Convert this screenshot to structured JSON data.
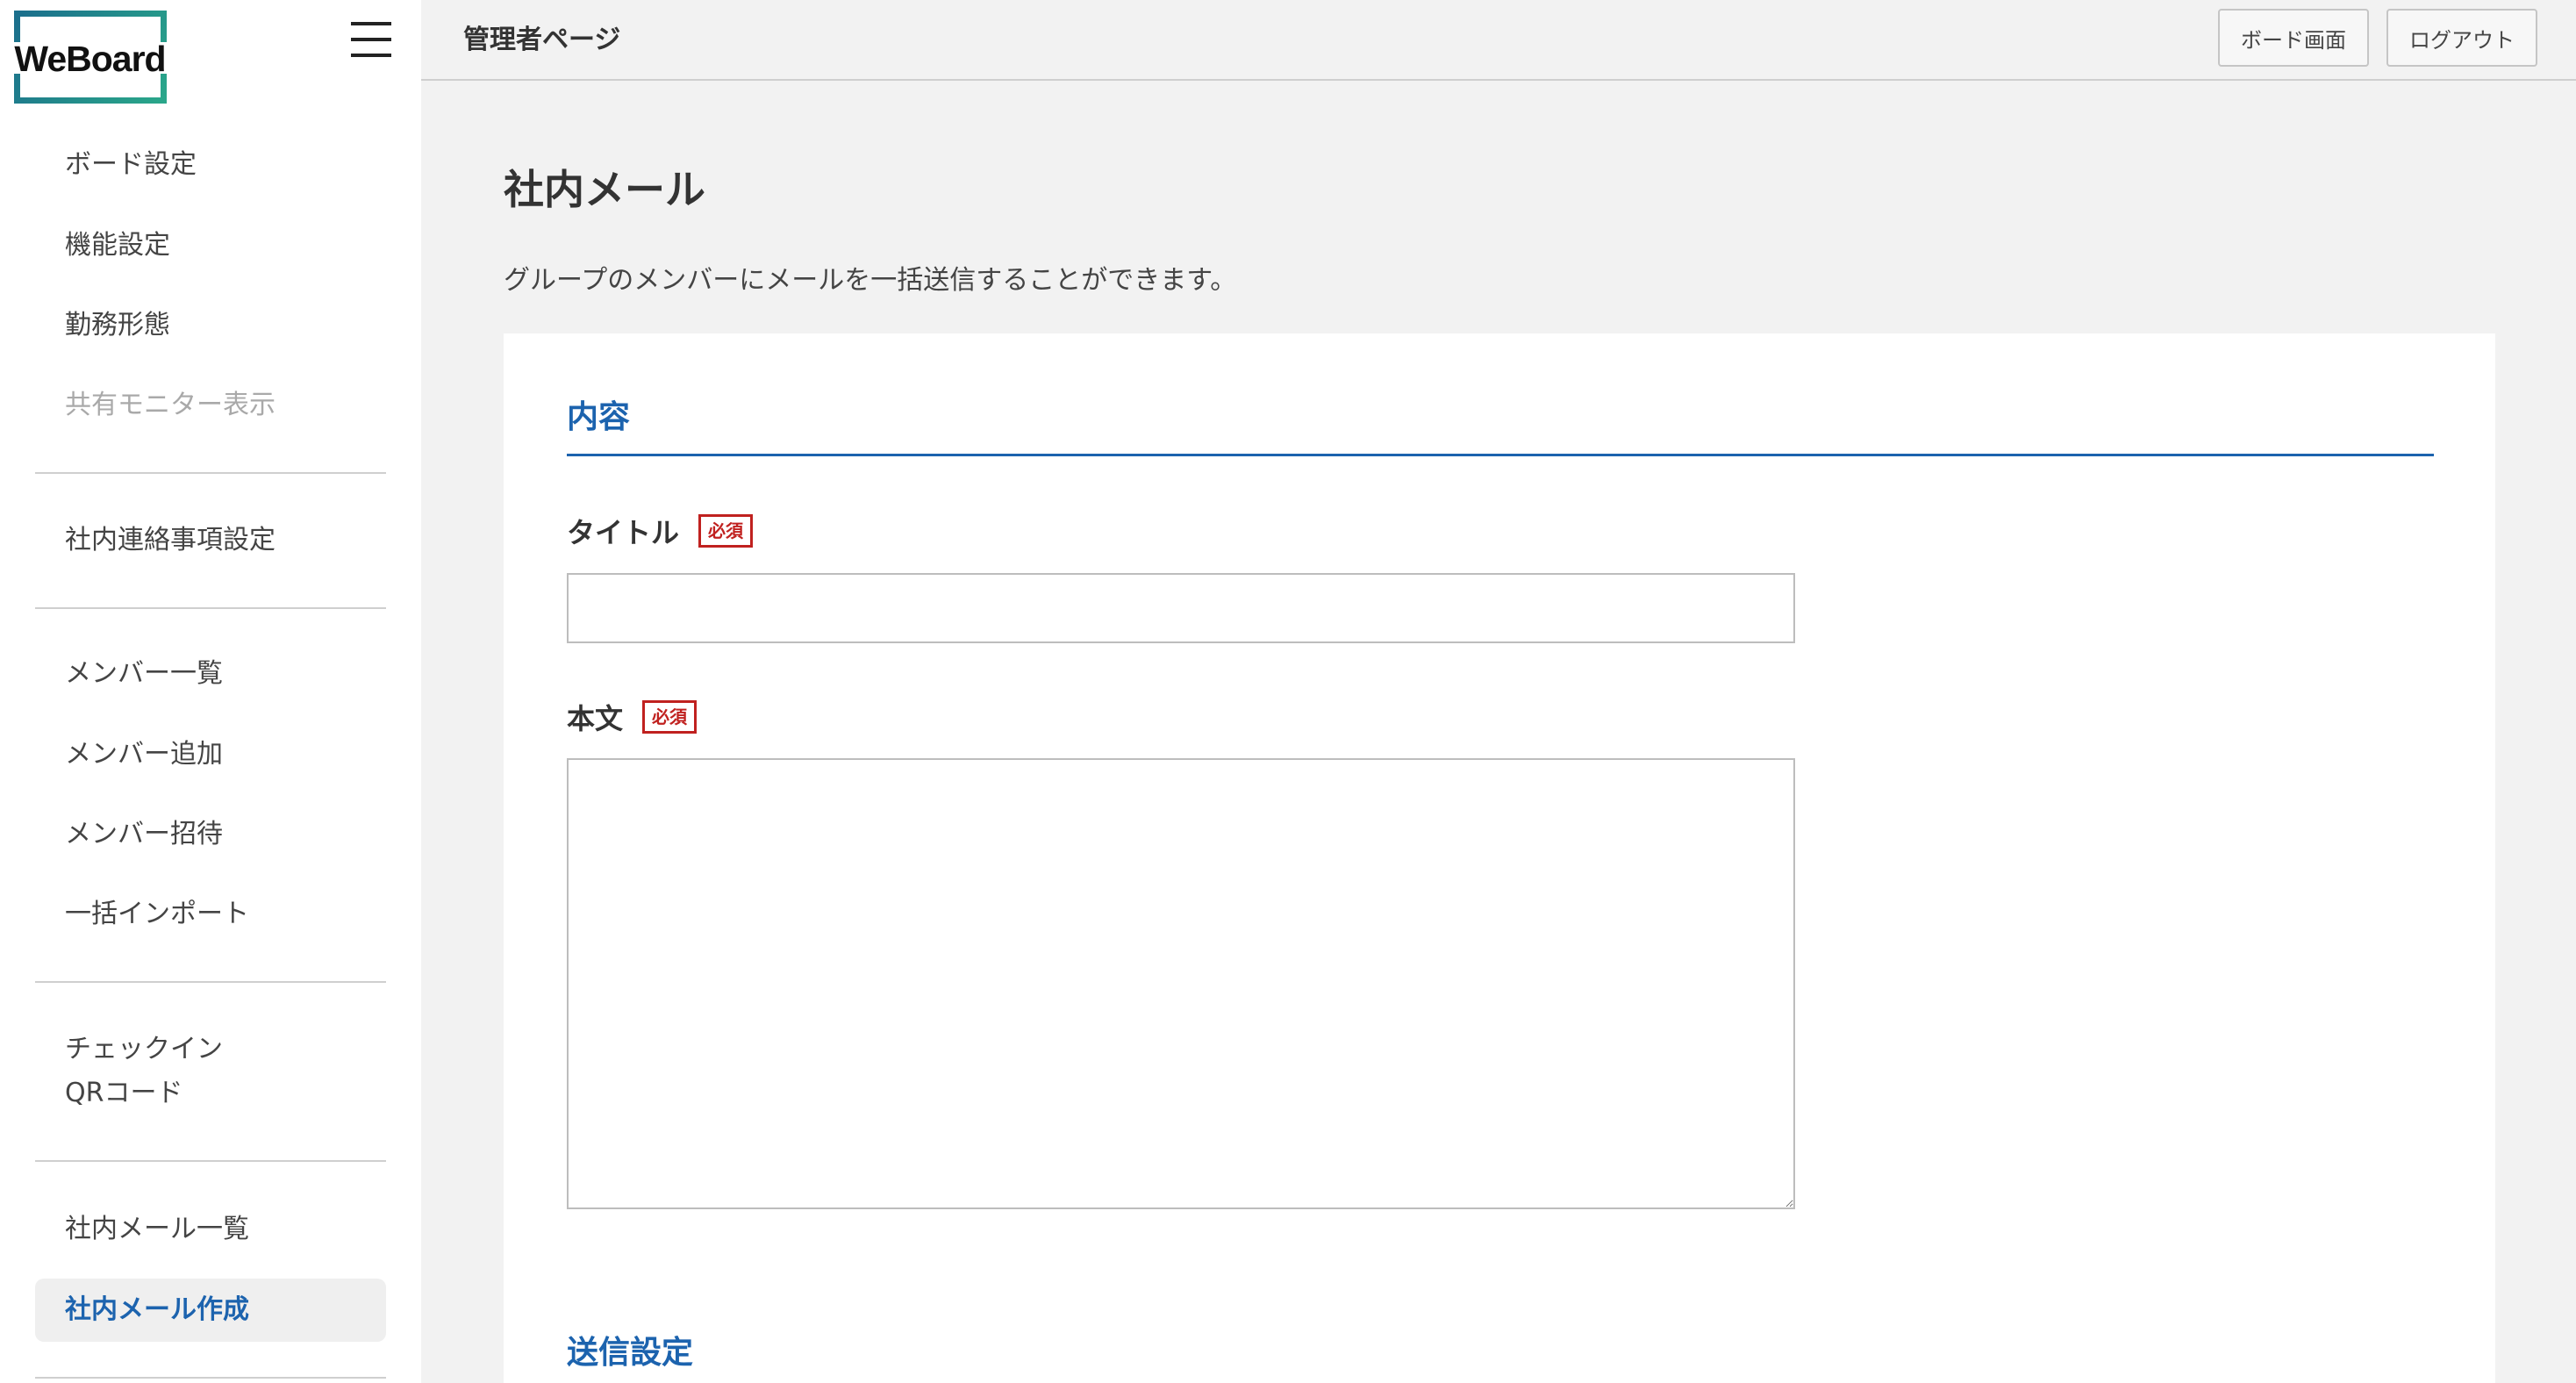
{
  "brand": {
    "logo_text": "WeBoard"
  },
  "header": {
    "title": "管理者ページ",
    "board_button": "ボード画面",
    "logout_button": "ログアウト"
  },
  "sidebar": {
    "items": [
      {
        "label": "ボード設定",
        "state": "normal"
      },
      {
        "label": "機能設定",
        "state": "normal"
      },
      {
        "label": "勤務形態",
        "state": "normal"
      },
      {
        "label": "共有モニター表示",
        "state": "disabled"
      },
      {
        "label": "社内連絡事項設定",
        "state": "normal"
      },
      {
        "label": "メンバー一覧",
        "state": "normal"
      },
      {
        "label": "メンバー追加",
        "state": "normal"
      },
      {
        "label": "メンバー招待",
        "state": "normal"
      },
      {
        "label": "一括インポート",
        "state": "normal"
      },
      {
        "label": "チェックイン",
        "state": "normal"
      },
      {
        "label": "QRコード",
        "state": "normal"
      },
      {
        "label": "社内メール一覧",
        "state": "normal"
      },
      {
        "label": "社内メール作成",
        "state": "active"
      }
    ]
  },
  "main": {
    "page_title": "社内メール",
    "description": "グループのメンバーにメールを一括送信することができます。",
    "content_section": {
      "heading": "内容",
      "title_field": {
        "label": "タイトル",
        "badge": "必須",
        "value": "",
        "placeholder": ""
      },
      "body_field": {
        "label": "本文",
        "badge": "必須",
        "value": "",
        "placeholder": ""
      }
    },
    "send_section": {
      "heading": "送信設定"
    }
  },
  "colors": {
    "accent": "#1c63ae",
    "required": "#c0211f",
    "background": "#f2f2f2",
    "card": "#ffffff"
  }
}
